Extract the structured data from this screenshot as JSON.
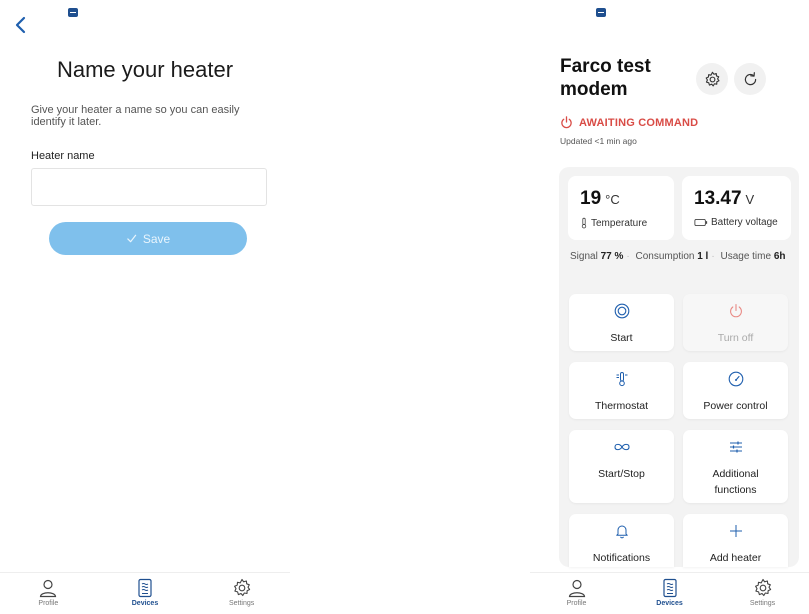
{
  "left": {
    "title": "Name your heater",
    "description": "Give your heater a name so you can easily identify it later.",
    "field_label": "Heater name",
    "field_value": "",
    "field_placeholder": "",
    "save_label": "Save"
  },
  "right": {
    "device_name": "Farco test modem",
    "status": "AWAITING COMMAND",
    "updated": "Updated <1 min ago",
    "temperature": {
      "value": "19",
      "unit": "°C",
      "label": "Temperature"
    },
    "battery": {
      "value": "13.47",
      "unit": "V",
      "label": "Battery voltage"
    },
    "info": {
      "signal_label": "Signal",
      "signal_value": "77 %",
      "consumption_label": "Consumption",
      "consumption_value": "1 l",
      "usage_label": "Usage time",
      "usage_value": "6h"
    },
    "actions": [
      {
        "label": "Start",
        "icon": "start-icon"
      },
      {
        "label": "Turn off",
        "icon": "power-icon"
      },
      {
        "label": "Thermostat",
        "icon": "thermostat-icon"
      },
      {
        "label": "Power control",
        "icon": "gauge-icon"
      },
      {
        "label": "Start/Stop",
        "icon": "infinity-icon"
      },
      {
        "label": "Additional functions",
        "icon": "sliders-icon"
      },
      {
        "label": "Notifications",
        "icon": "bell-icon"
      },
      {
        "label": "Add heater",
        "icon": "plus-icon"
      }
    ]
  },
  "nav": {
    "profile": "Profile",
    "devices": "Devices",
    "settings": "Settings"
  },
  "colors": {
    "accent": "#1f4f8f",
    "save_button": "#7fc0ec",
    "status_red": "#d94c46",
    "panel_bg": "#f3f3f3"
  }
}
